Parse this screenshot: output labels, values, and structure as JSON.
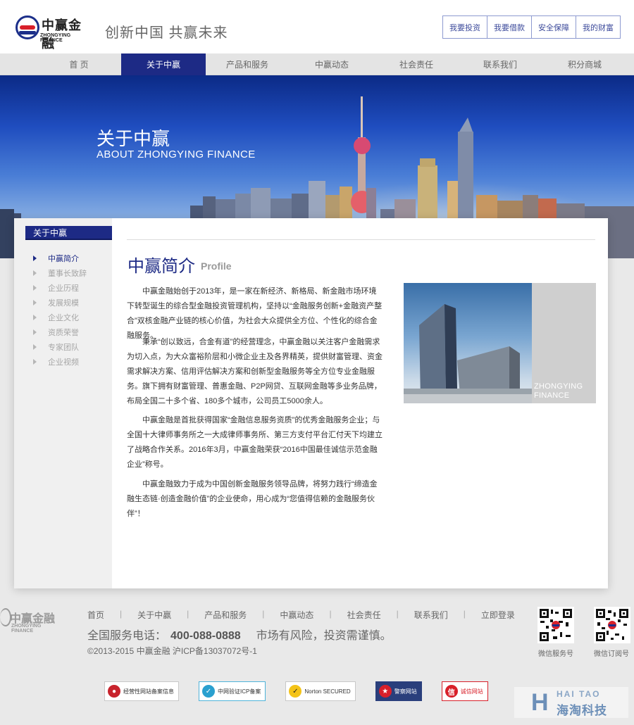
{
  "header": {
    "logo_cn": "中赢金融",
    "logo_en": "ZHONGYING FINANCE",
    "slogan": "创新中国 共赢未来",
    "top_buttons": [
      "我要投资",
      "我要借款",
      "安全保障",
      "我的财富"
    ]
  },
  "nav": {
    "items": [
      "首 页",
      "关于中赢",
      "产品和服务",
      "中赢动态",
      "社会责任",
      "联系我们",
      "积分商城"
    ],
    "active": "关于中赢"
  },
  "banner": {
    "title": "关于中赢",
    "subtitle": "ABOUT ZHONGYING FINANCE"
  },
  "sidebar": {
    "heading": "关于中赢",
    "items": [
      "中赢简介",
      "董事长致辞",
      "企业历程",
      "发展规模",
      "企业文化",
      "资质荣誉",
      "专家团队",
      "企业视频"
    ],
    "active": "中赢简介"
  },
  "main": {
    "title": "中赢简介",
    "title_en": "Profile",
    "paragraphs": [
      "中赢金融始创于2013年，是一家在新经济、新格局、新金融市场环境下转型诞生的综合型金融投资管理机构，坚持以“金融服务创新+金融资产整合”双核金融产业链的核心价值，为社会大众提供全方位、个性化的综合金融服务。",
      "秉承“创以致远，合金有道”的经营理念，中赢金融以关注客户金融需求为切入点，为大众富裕阶层和小微企业主及各界精英，提供财富管理、资金需求解决方案、信用评估解决方案和创新型金融服务等全方位专业金融服务。旗下拥有财富管理、普惠金融、P2P网贷、互联网金融等多业务品牌，布局全国二十多个省、180多个城市，公司员工5000余人。",
      "中赢金融是首批获得国家“金融信息服务资质”的优秀金融服务企业；与全国十大律师事务所之一大成律师事务所、第三方支付平台汇付天下均建立了战略合作关系。2016年3月，中赢金融荣获“2016中国最佳诚信示范金融企业”称号。",
      "中赢金融致力于成为中国创新金融服务领导品牌，将努力践行“缔造金融生态链·创造金融价值”的企业使命，用心成为“您值得信赖的金融服务伙伴”！"
    ],
    "photo_caption_1": "ZHONGYING",
    "photo_caption_2": "FINANCE"
  },
  "footer": {
    "logo_cn": "中赢金融",
    "logo_en": "ZHONGYING FINANCE",
    "nav": [
      "首页",
      "关于中赢",
      "产品和服务",
      "中赢动态",
      "社会责任",
      "联系我们",
      "立即登录"
    ],
    "phone_label": "全国服务电话：",
    "phone": "400-088-0888",
    "risk": "市场有风险，投资需谨慎。",
    "copyright": "©2013-2015 中赢金融 沪ICP备13037072号-1",
    "qr_labels": [
      "微信服务号",
      "微信订阅号"
    ],
    "badges": [
      "经营性网站备案信息",
      "中网验证ICP备案",
      "Norton SECURED",
      "警察网站",
      "诚信网站"
    ],
    "watermark_en": "HAI TAO",
    "watermark_cn": "海淘科技"
  },
  "colors": {
    "brand_blue": "#1d2a85",
    "page_bg": "#e9e9e9"
  }
}
